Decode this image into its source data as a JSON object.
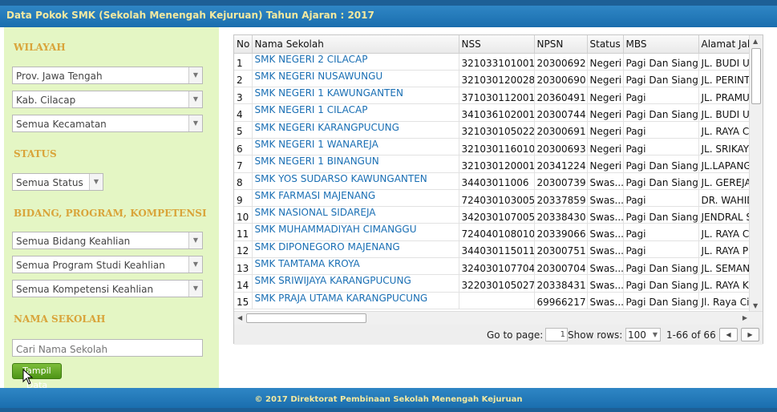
{
  "header": {
    "title": "Data Pokok SMK (Sekolah Menengah Kejuruan) Tahun Ajaran : 2017"
  },
  "filters": {
    "wilayah_label": "WILAYAH",
    "provinsi": "Prov. Jawa Tengah",
    "kabupaten": "Kab. Cilacap",
    "kecamatan": "Semua Kecamatan",
    "status_label": "STATUS",
    "status": "Semua Status",
    "bidang_label": "BIDANG, PROGRAM, KOMPETENSI",
    "bidang": "Semua Bidang Keahlian",
    "program": "Semua Program Studi Keahlian",
    "kompetensi": "Semua Kompetensi Keahlian",
    "nama_label": "NAMA SEKOLAH",
    "nama_placeholder": "Cari Nama Sekolah",
    "tampil_button": "Tampil Data"
  },
  "table": {
    "columns": [
      "No",
      "Nama Sekolah",
      "NSS",
      "NPSN",
      "Status",
      "MBS",
      "Alamat Jal"
    ],
    "rows": [
      [
        "1",
        "SMK NEGERI 2 CILACAP",
        "321033101001",
        "20300692",
        "Negeri",
        "Pagi Dan Siang",
        "JL. BUDI U"
      ],
      [
        "2",
        "SMK NEGERI NUSAWUNGU",
        "321030120028",
        "20300690",
        "Negeri",
        "Pagi Dan Siang",
        "JL. PERINT"
      ],
      [
        "3",
        "SMK NEGERI 1 KAWUNGANTEN",
        "371030112001",
        "20360491",
        "Negeri",
        "Pagi",
        "JL. PRAMU"
      ],
      [
        "4",
        "SMK NEGERI 1 CILACAP",
        "341036102001",
        "20300744",
        "Negeri",
        "Pagi Dan Siang",
        "JL. BUDI U"
      ],
      [
        "5",
        "SMK NEGERI KARANGPUCUNG",
        "321030105022",
        "20300691",
        "Negeri",
        "Pagi",
        "JL. RAYA C"
      ],
      [
        "6",
        "SMK NEGERI 1 WANAREJA",
        "321030116010",
        "20300693",
        "Negeri",
        "Pagi",
        "JL. SRIKAY"
      ],
      [
        "7",
        "SMK NEGERI 1 BINANGUN",
        "321030120001",
        "20341224",
        "Negeri",
        "Pagi Dan Siang",
        "JL.LAPANG"
      ],
      [
        "8",
        "SMK YOS SUDARSO KAWUNGANTEN",
        "34403011006",
        "20300739",
        "Swas...",
        "Pagi Dan Siang",
        "JL. GEREJA"
      ],
      [
        "9",
        "SMK FARMASI MAJENANG",
        "724030103005",
        "20337859",
        "Swas...",
        "Pagi",
        "DR. WAHID"
      ],
      [
        "10",
        "SMK NASIONAL SIDAREJA",
        "342030107005",
        "20338430",
        "Swas...",
        "Pagi Dan Siang",
        "JENDRAL S"
      ],
      [
        "11",
        "SMK MUHAMMADIYAH CIMANGGU",
        "724040108010",
        "20339066",
        "Swas...",
        "Pagi",
        "JL. RAYA C"
      ],
      [
        "12",
        "SMK DIPONEGORO MAJENANG",
        "344030115011",
        "20300751",
        "Swas...",
        "Pagi",
        "JL. RAYA P"
      ],
      [
        "13",
        "SMK TAMTAMA KROYA",
        "324030107704",
        "20300704",
        "Swas...",
        "Pagi Dan Siang",
        "JL. SEMAN"
      ],
      [
        "14",
        "SMK SRIWIJAYA KARANGPUCUNG",
        "322030105027",
        "20338431",
        "Swas...",
        "Pagi Dan Siang",
        "JL. RAYA K"
      ],
      [
        "15",
        "SMK PRAJA UTAMA KARANGPUCUNG",
        "",
        "69966217",
        "Swas...",
        "Pagi Dan Siang",
        "Jl. Raya Ci"
      ]
    ]
  },
  "pager": {
    "goto_label": "Go to page:",
    "page_value": "1",
    "show_rows_label": "Show rows:",
    "rows_value": "100",
    "range": "1-66 of 66"
  },
  "footer": {
    "text": "© 2017 Direktorat Pembinaan Sekolah Menengah Kejuruan"
  },
  "colors": {
    "header_bg": "#1f74b6",
    "sidebar_bg": "#e4f6c4",
    "label_gold": "#d9a43a",
    "link_blue": "#1a6fb4"
  },
  "icons": [
    "dropdown-arrow-icon",
    "scroll-arrow-icon",
    "mouse-cursor-icon"
  ]
}
